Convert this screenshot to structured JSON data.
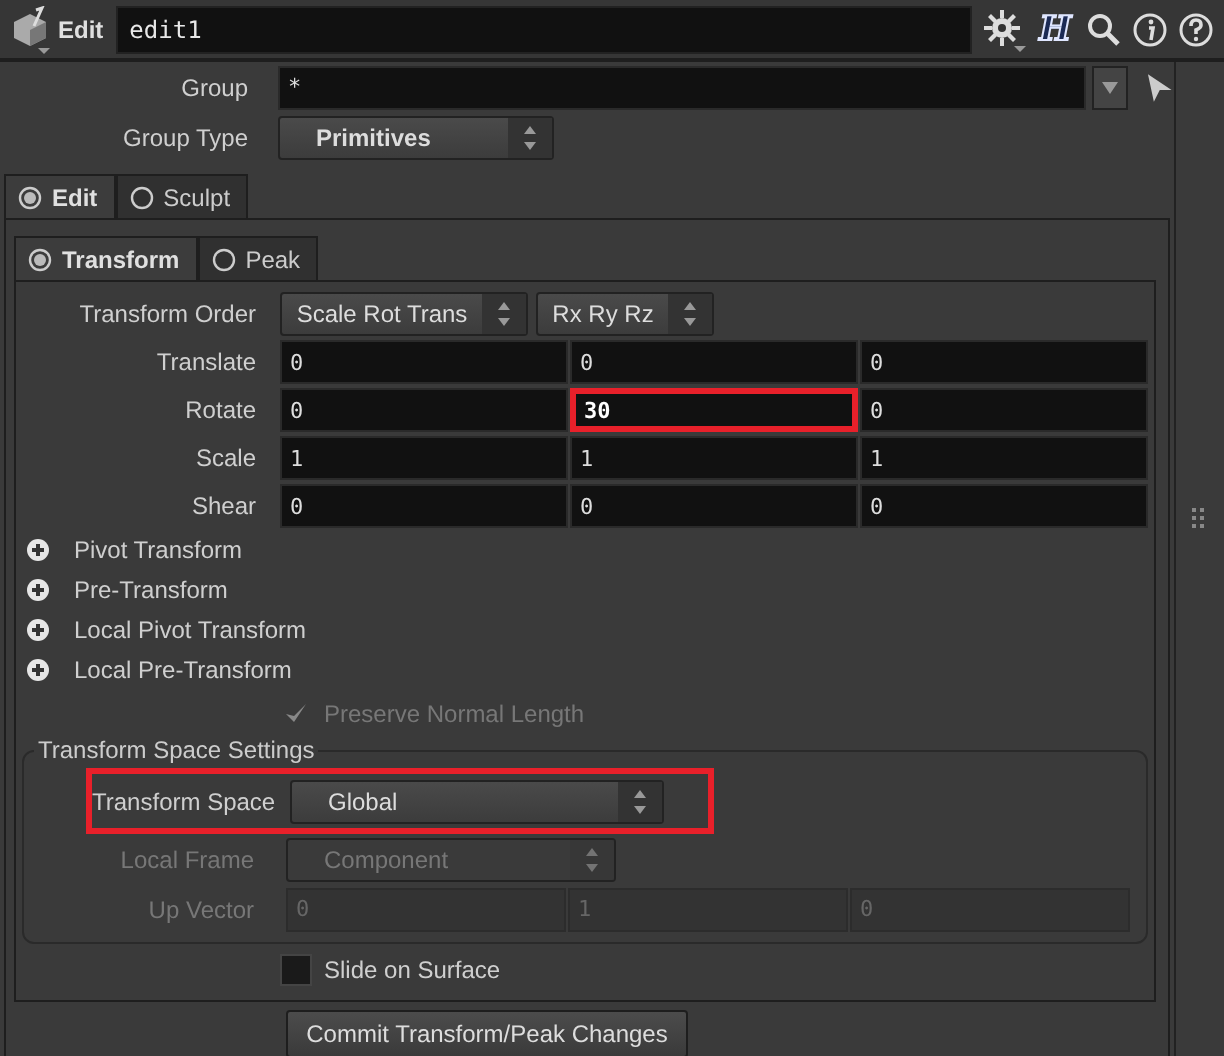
{
  "header": {
    "node_type": "Edit",
    "name": "edit1",
    "menu_letter": "H"
  },
  "group": {
    "label": "Group",
    "value": "*"
  },
  "group_type": {
    "label": "Group Type",
    "value": "Primitives"
  },
  "tabs": [
    {
      "label": "Edit",
      "selected": true
    },
    {
      "label": "Sculpt",
      "selected": false
    }
  ],
  "subtabs": [
    {
      "label": "Transform",
      "selected": true
    },
    {
      "label": "Peak",
      "selected": false
    }
  ],
  "transform_order": {
    "label": "Transform Order",
    "values": [
      "Scale Rot Trans",
      "Rx Ry Rz"
    ]
  },
  "vectors": [
    {
      "label": "Translate",
      "values": [
        {
          "value": "0",
          "modified": false,
          "highlighted": false
        },
        {
          "value": "0",
          "modified": false,
          "highlighted": false
        },
        {
          "value": "0",
          "modified": false,
          "highlighted": false
        }
      ]
    },
    {
      "label": "Rotate",
      "values": [
        {
          "value": "0",
          "modified": false,
          "highlighted": false
        },
        {
          "value": "30",
          "modified": true,
          "highlighted": true
        },
        {
          "value": "0",
          "modified": false,
          "highlighted": false
        }
      ]
    },
    {
      "label": "Scale",
      "values": [
        {
          "value": "1",
          "modified": false,
          "highlighted": false
        },
        {
          "value": "1",
          "modified": false,
          "highlighted": false
        },
        {
          "value": "1",
          "modified": false,
          "highlighted": false
        }
      ]
    },
    {
      "label": "Shear",
      "values": [
        {
          "value": "0",
          "modified": false,
          "highlighted": false
        },
        {
          "value": "0",
          "modified": false,
          "highlighted": false
        },
        {
          "value": "0",
          "modified": false,
          "highlighted": false
        }
      ]
    }
  ],
  "folders": [
    {
      "label": "Pivot Transform",
      "expanded": false
    },
    {
      "label": "Pre-Transform",
      "expanded": false
    },
    {
      "label": "Local Pivot Transform",
      "expanded": false
    },
    {
      "label": "Local Pre-Transform",
      "expanded": false
    }
  ],
  "preserve_normal_length": {
    "label": "Preserve Normal Length",
    "checked": true,
    "disabled": true
  },
  "transform_space_settings": {
    "title": "Transform Space Settings",
    "rows": [
      {
        "kind": "menu",
        "label": "Transform Space",
        "value": "Global",
        "disabled": false,
        "highlighted": true
      },
      {
        "kind": "menu",
        "label": "Local Frame",
        "value": "Component",
        "disabled": true,
        "highlighted": false
      },
      {
        "kind": "vector",
        "label": "Up Vector",
        "values": [
          "0",
          "1",
          "0"
        ],
        "disabled": true,
        "highlighted": false
      }
    ]
  },
  "slide_on_surface": {
    "label": "Slide on Surface",
    "checked": false
  },
  "commit_button": {
    "label": "Commit Transform/Peak Changes"
  }
}
